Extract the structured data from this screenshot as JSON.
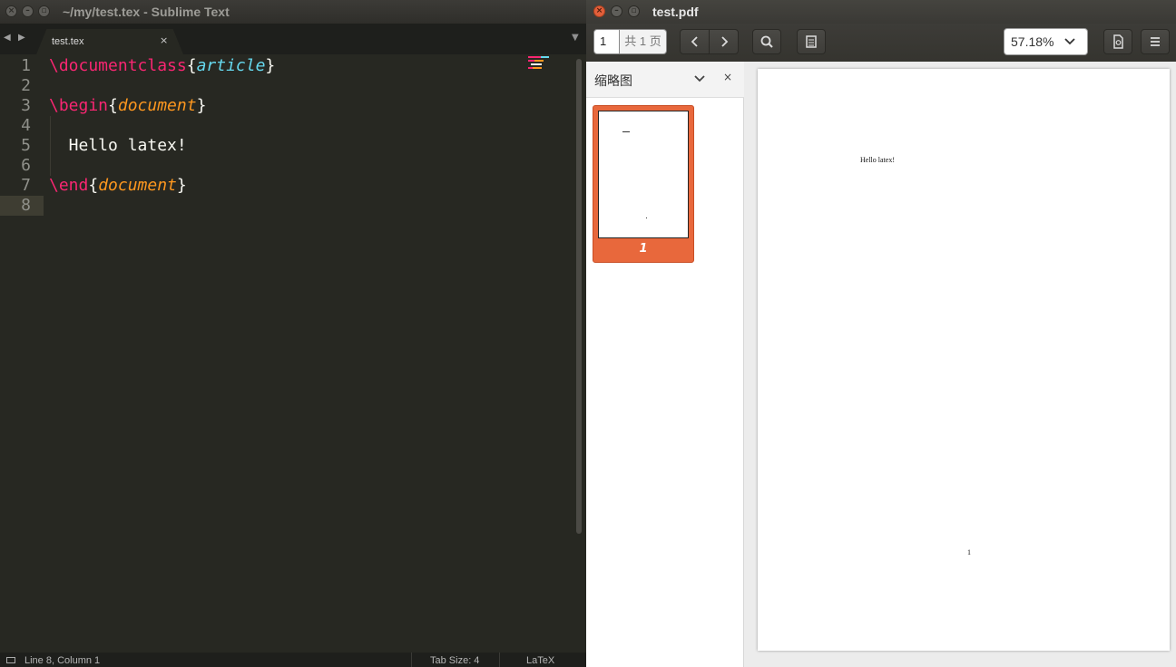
{
  "sublime": {
    "window_title": "~/my/test.tex - Sublime Text",
    "tab_label": "test.tex",
    "tab_close": "×",
    "nav_back": "◀",
    "nav_forward": "▶",
    "tab_dropdown": "▼",
    "line_numbers": [
      "1",
      "2",
      "3",
      "4",
      "5",
      "6",
      "7",
      "8"
    ],
    "current_line": 8,
    "code": {
      "l1_cmd": "\\documentclass",
      "l1_open": "{",
      "l1_arg": "article",
      "l1_close": "}",
      "l3_cmd": "\\begin",
      "l3_open": "{",
      "l3_arg": "document",
      "l3_close": "}",
      "l5_text": "  Hello latex!",
      "l7_cmd": "\\end",
      "l7_open": "{",
      "l7_arg": "document",
      "l7_close": "}"
    },
    "status": {
      "position": "Line 8, Column 1",
      "tab_size": "Tab Size: 4",
      "syntax": "LaTeX"
    },
    "colors": {
      "background": "#272822",
      "keyword": "#f92672",
      "arg_cyan": "#66d9ef",
      "arg_orange": "#fd971f"
    }
  },
  "evince": {
    "window_title": "test.pdf",
    "page_input": "1",
    "page_total": "共 1 页",
    "zoom": "57.18%",
    "zoom_caret": "❯",
    "sidebar_title": "缩略图",
    "sidebar_close": "×",
    "thumbnail_label": "1",
    "pdf_body_text": "Hello latex!",
    "pdf_page_number": "1",
    "colors": {
      "thumbnail_highlight": "#e8683c",
      "close_button": "#e25f3b"
    }
  }
}
